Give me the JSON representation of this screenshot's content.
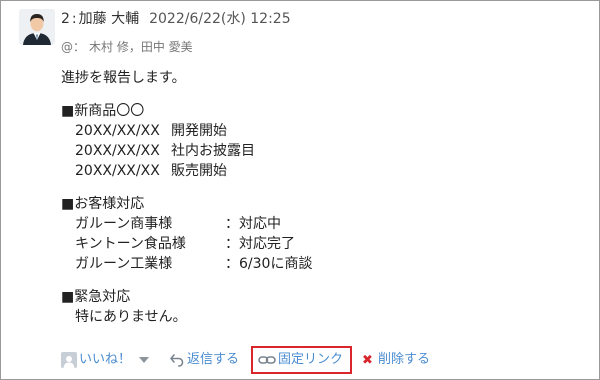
{
  "post": {
    "number": "2",
    "separator": ":",
    "author": "加藤 大輔",
    "timestamp": "2022/6/22(水) 12:25",
    "mentions_prefix": "@：",
    "mentions": "木村 修，田中 愛美",
    "body_lines": [
      "進捗を報告します。",
      "",
      "■新商品〇〇",
      "",
      "",
      "",
      "",
      "■お客様対応",
      "",
      "",
      "",
      "",
      "■緊急対応",
      "特にありません。"
    ],
    "schedule": [
      {
        "date": "20XX/XX/XX",
        "event": "開発開始"
      },
      {
        "date": "20XX/XX/XX",
        "event": "社内お披露目"
      },
      {
        "date": "20XX/XX/XX",
        "event": "販売開始"
      }
    ],
    "customers": [
      {
        "name": "ガルーン商事様",
        "status": "：対応中"
      },
      {
        "name": "キントーン食品様",
        "status": "：対応完了"
      },
      {
        "name": "ガルーン工業様",
        "status": "：6/30に商談"
      }
    ]
  },
  "actions": {
    "like_label": "いいね！",
    "reply_label": "返信する",
    "permalink_label": "固定リンク",
    "delete_label": "削除する"
  },
  "colors": {
    "link": "#4a8cd1",
    "highlight_border": "#d9262c",
    "delete_icon": "#d9262c"
  }
}
